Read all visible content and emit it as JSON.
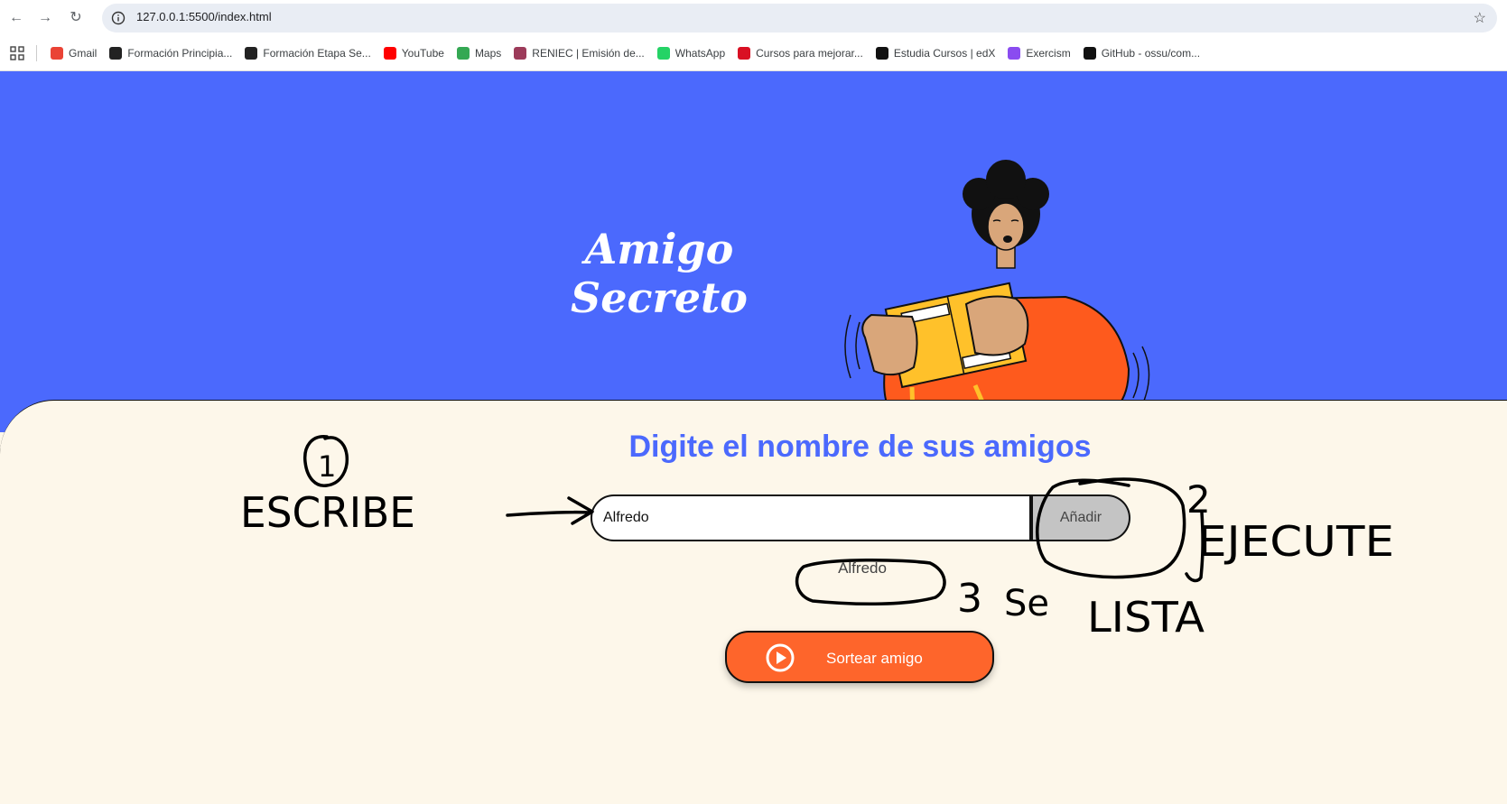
{
  "browser": {
    "url": "127.0.0.1:5500/index.html",
    "bookmarks": [
      {
        "label": "Gmail",
        "icon": "gmail-icon",
        "color": "#ea4335"
      },
      {
        "label": "Formación Principia...",
        "icon": "alura-icon",
        "color": "#222222"
      },
      {
        "label": "Formación Etapa Se...",
        "icon": "alura-icon",
        "color": "#222222"
      },
      {
        "label": "YouTube",
        "icon": "youtube-icon",
        "color": "#ff0000"
      },
      {
        "label": "Maps",
        "icon": "maps-icon",
        "color": "#34a853"
      },
      {
        "label": "RENIEC | Emisión de...",
        "icon": "reniec-icon",
        "color": "#9c3b5a"
      },
      {
        "label": "WhatsApp",
        "icon": "whatsapp-icon",
        "color": "#25d366"
      },
      {
        "label": "Cursos para mejorar...",
        "icon": "peru-flag-icon",
        "color": "#d91023"
      },
      {
        "label": "Estudia Cursos | edX",
        "icon": "edx-icon",
        "color": "#111111"
      },
      {
        "label": "Exercism",
        "icon": "exercism-icon",
        "color": "#8a4cf0"
      },
      {
        "label": "GitHub - ossu/com...",
        "icon": "github-icon",
        "color": "#111111"
      }
    ]
  },
  "page": {
    "title": "Amigo Secreto",
    "heading": "Digite el nombre de sus amigos",
    "input_value": "Alfredo",
    "add_label": "Añadir",
    "friends": [
      "Alfredo"
    ],
    "draw_label": "Sortear amigo"
  },
  "annotations": {
    "step1_number": "1",
    "step1_text": "ESCRIBE",
    "step2_number": "2",
    "step2_text": "EJECUTE",
    "step3_number": "3",
    "step3_text": "Se",
    "step3_text2": "LISTA"
  },
  "colors": {
    "hero": "#4b69fd",
    "accent_blue": "#4b69fd",
    "background": "#fdf7ea",
    "draw_button": "#fe652b",
    "add_button": "#c4c4c4"
  }
}
